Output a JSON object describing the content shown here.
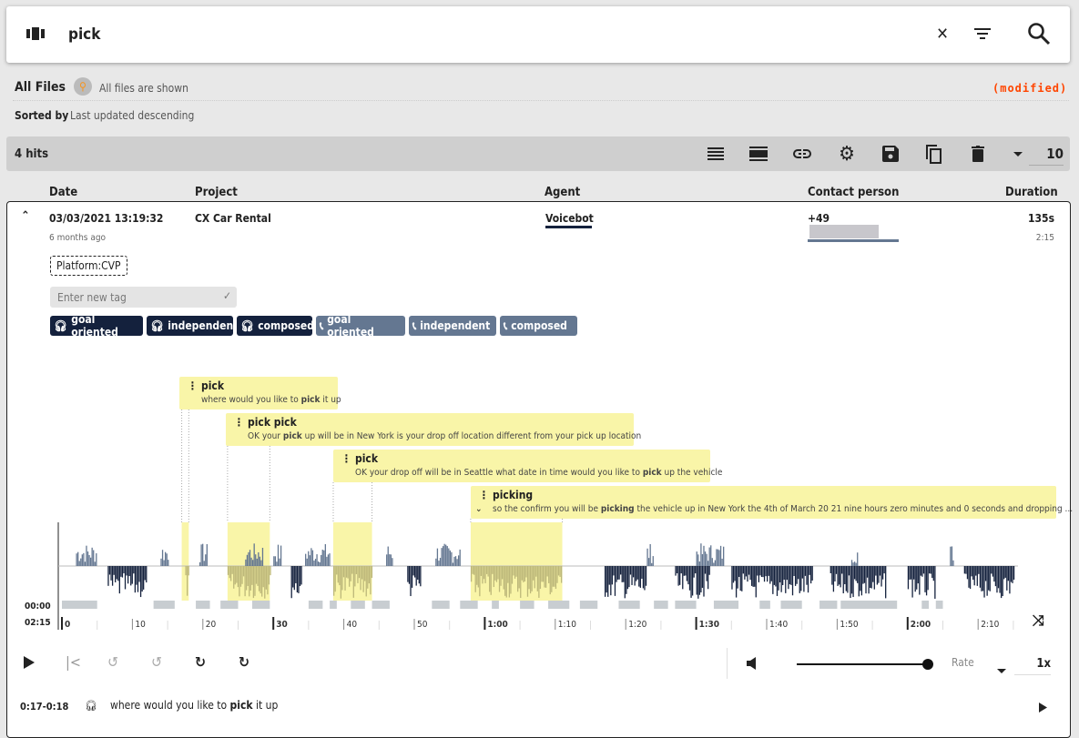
{
  "search": {
    "query": "pick",
    "icons": [
      "columns-icon",
      "clear-icon",
      "filter-icon",
      "search-icon"
    ]
  },
  "files": {
    "title": "All Files",
    "info": "All files are shown",
    "modified": "(modified)",
    "sorted_label": "Sorted by",
    "sorted_value": "Last updated descending"
  },
  "toolbar": {
    "hits": "4 hits",
    "page_size": "10",
    "icons": [
      "list-icon",
      "compact-list-icon",
      "link-icon",
      "gear-icon",
      "save-icon",
      "copy-icon",
      "delete-icon",
      "dropdown-icon"
    ]
  },
  "columns": {
    "date": "Date",
    "project": "Project",
    "agent": "Agent",
    "contact": "Contact person",
    "duration": "Duration"
  },
  "row": {
    "date": "03/03/2021 13:19:32",
    "ago": "6 months ago",
    "project": "CX Car Rental",
    "agent": "Voicebot",
    "contact": "+49",
    "duration": "135s",
    "duration_fmt": "2:15",
    "platform_tag": "Platform:CVP",
    "new_tag_placeholder": "Enter new tag",
    "tags": [
      {
        "label": "goal oriented",
        "type": "agent"
      },
      {
        "label": "independent",
        "type": "agent"
      },
      {
        "label": "composed",
        "type": "agent"
      },
      {
        "label": "goal oriented",
        "type": "customer"
      },
      {
        "label": "independent",
        "type": "customer"
      },
      {
        "label": "composed",
        "type": "customer"
      }
    ]
  },
  "annotations": [
    {
      "title": "pick",
      "pre": "where would you like to ",
      "hit": "pick",
      "post": " it up"
    },
    {
      "title": "pick pick",
      "pre": "OK your ",
      "hit": "pick",
      "post": " up will be in New York is your drop off location different from your pick up location"
    },
    {
      "title": "pick",
      "pre": "OK your drop off will be in Seattle what date in time would you like to ",
      "hit": "pick",
      "post": " up the vehicle"
    },
    {
      "title": "picking",
      "pre": "so the confirm you will be ",
      "hit": "picking",
      "post": " the vehicle up in New York the 4th of March 20 21 nine hours zero minutes and 0 seconds and dropping ..."
    }
  ],
  "player": {
    "start": "00:00",
    "end": "02:15",
    "ticks": [
      "0",
      "10",
      "20",
      "30",
      "40",
      "50",
      "1:00",
      "1:10",
      "1:20",
      "1:30",
      "1:40",
      "1:50",
      "2:00",
      "2:10"
    ],
    "rate_label": "Rate",
    "rate": "1x",
    "volume": 1.0,
    "highlight_ranges_s": [
      [
        17,
        18
      ],
      [
        23.5,
        29.5
      ],
      [
        38.5,
        44
      ],
      [
        58,
        71
      ]
    ]
  },
  "transcript": [
    {
      "time": "0:17-0:18",
      "pre": "where would you like to ",
      "hit": "pick",
      "post": " it up"
    }
  ],
  "colors": {
    "navy": "#14213d",
    "slate": "#647791",
    "highlight": "#f9f5a8",
    "modified": "#ff4500"
  }
}
